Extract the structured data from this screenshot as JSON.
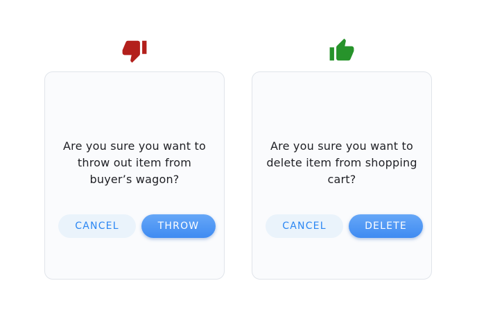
{
  "colors": {
    "thumbs_down": "#b3201c",
    "thumbs_up": "#27932b",
    "accent_blue": "#2a86f3",
    "cancel_bg": "#eaf3fb",
    "text": "#1e1f24"
  },
  "bad_example": {
    "icon": "thumbs-down-icon",
    "message": "Are you sure you want to throw out item from buyer’s wagon?",
    "cancel_label": "CANCEL",
    "confirm_label": "THROW"
  },
  "good_example": {
    "icon": "thumbs-up-icon",
    "message": "Are you sure you want to delete item from shopping cart?",
    "cancel_label": "CANCEL",
    "confirm_label": "DELETE"
  }
}
